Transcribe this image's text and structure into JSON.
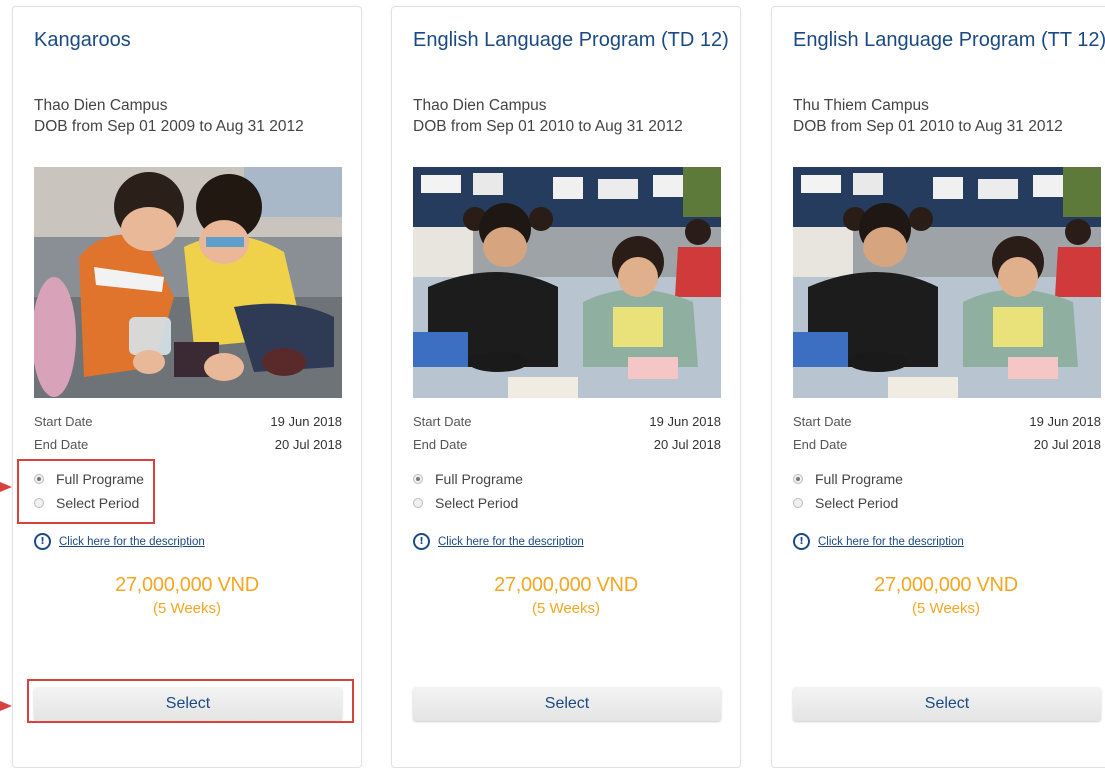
{
  "cards": [
    {
      "title": "Kangaroos",
      "campus": "Thao Dien Campus",
      "dob": "DOB from Sep 01 2009 to Aug 31 2012",
      "photo_icon": "children-playing-photo",
      "start_label": "Start Date",
      "start_value": "19 Jun 2018",
      "end_label": "End Date",
      "end_value": "20 Jul 2018",
      "option_full": "Full Programe",
      "option_period": "Select Period",
      "selected_option": "Full Programe",
      "description_link": "Click here for the description",
      "price": "27,000,000 VND",
      "duration": "(5 Weeks)",
      "button": "Select"
    },
    {
      "title": "English Language Program (TD 12)",
      "campus": "Thao Dien Campus",
      "dob": "DOB from Sep 01 2010 to Aug 31 2012",
      "photo_icon": "classroom-students-photo",
      "start_label": "Start Date",
      "start_value": "19 Jun 2018",
      "end_label": "End Date",
      "end_value": "20 Jul 2018",
      "option_full": "Full Programe",
      "option_period": "Select Period",
      "selected_option": "Full Programe",
      "description_link": "Click here for the description",
      "price": "27,000,000 VND",
      "duration": "(5 Weeks)",
      "button": "Select"
    },
    {
      "title": "English Language Program (TT 12)",
      "campus": "Thu Thiem Campus",
      "dob": "DOB from Sep 01 2010 to Aug 31 2012",
      "photo_icon": "classroom-students-photo",
      "start_label": "Start Date",
      "start_value": "19 Jun 2018",
      "end_label": "End Date",
      "end_value": "20 Jul 2018",
      "option_full": "Full Programe",
      "option_period": "Select Period",
      "selected_option": "Full Programe",
      "description_link": "Click here for the description",
      "price": "27,000,000 VND",
      "duration": "(5 Weeks)",
      "button": "Select"
    }
  ],
  "colors": {
    "title": "#1b4a83",
    "price": "#f5a623",
    "highlight": "#d9413d"
  }
}
